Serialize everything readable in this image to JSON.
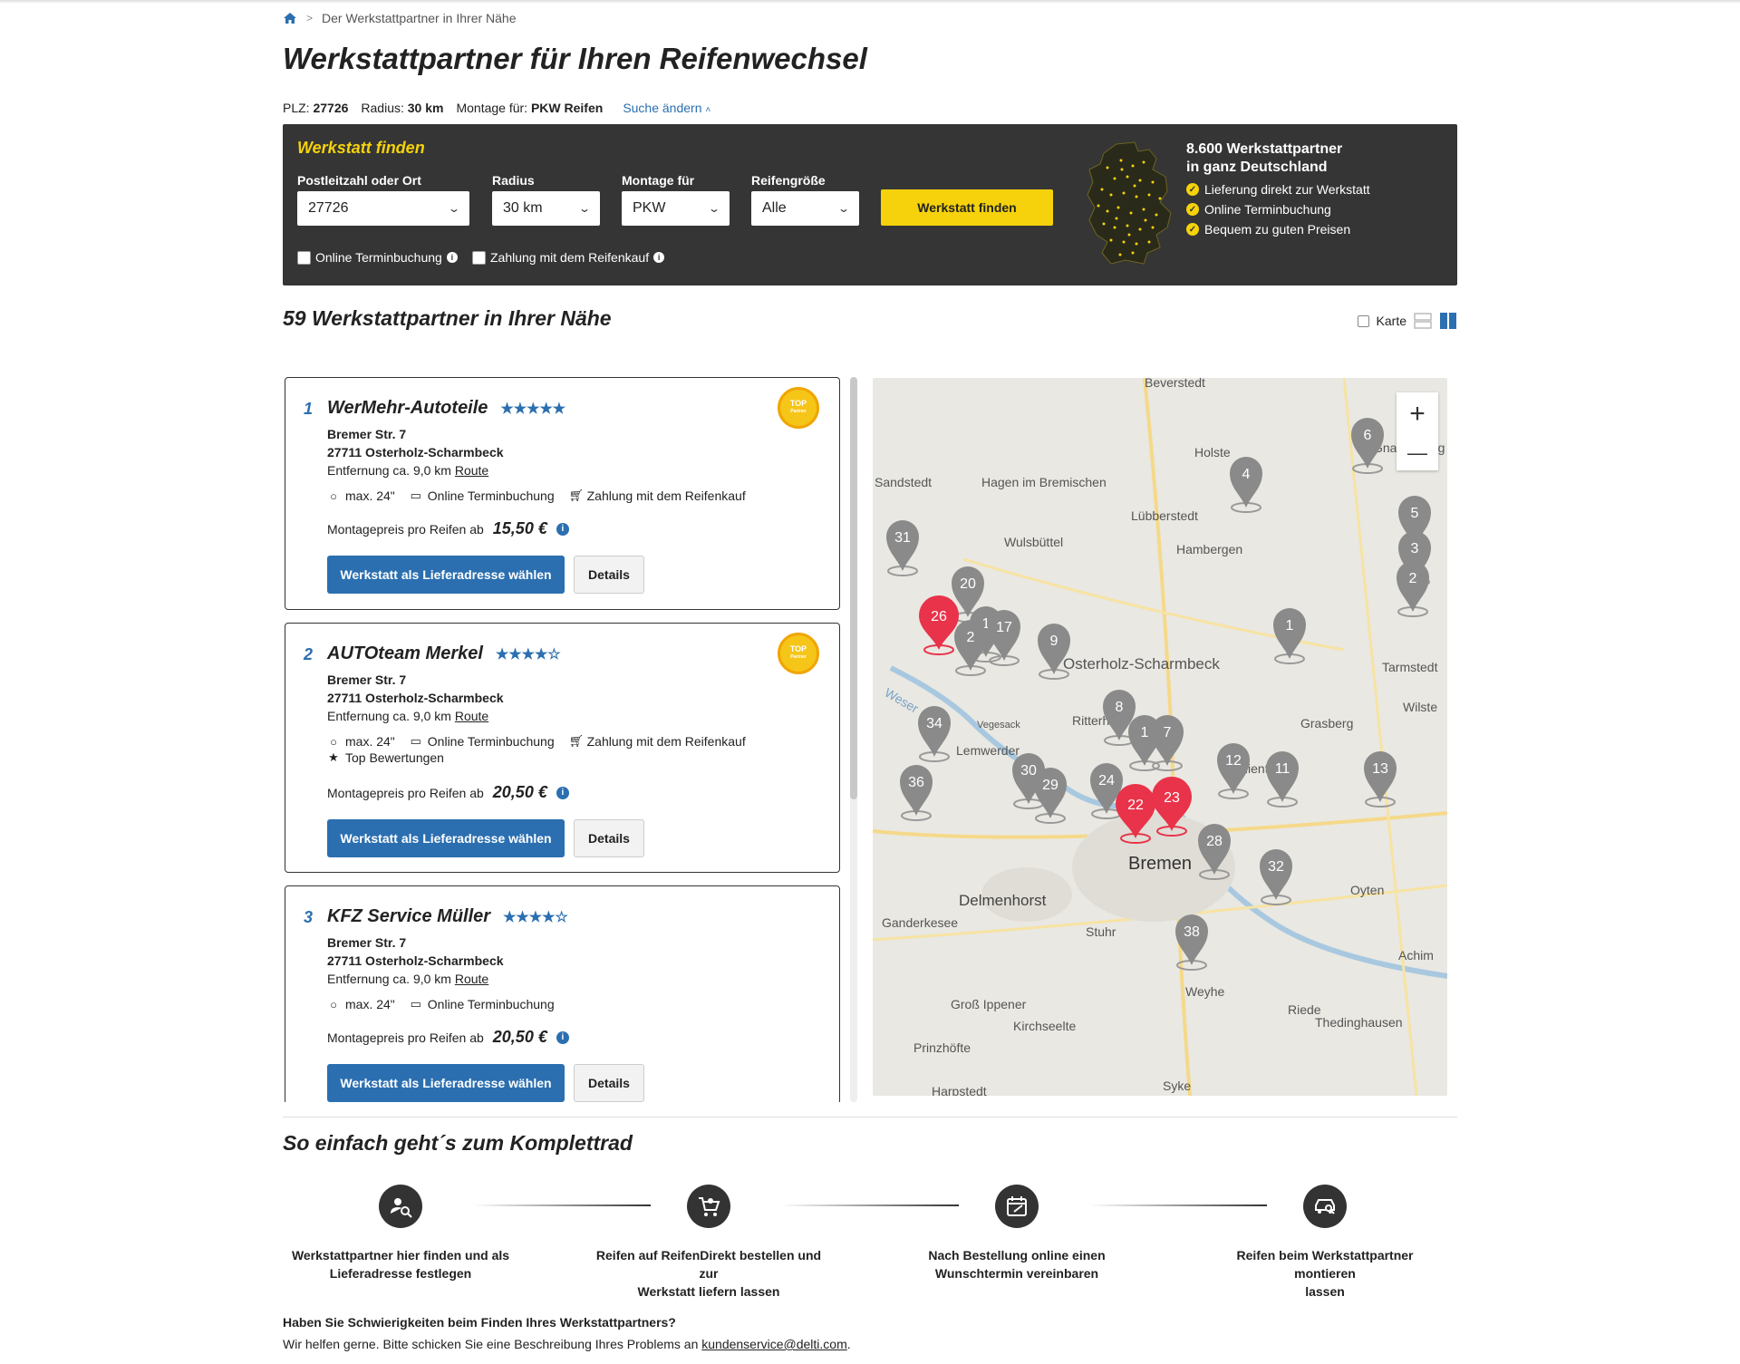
{
  "breadcrumb": {
    "home_icon": "home-icon",
    "current": "Der Werkstattpartner in Ihrer Nähe"
  },
  "page_title": "Werkstattpartner für Ihren Reifenwechsel",
  "summary": {
    "plz_label": "PLZ:",
    "plz_value": "27726",
    "radius_label": "Radius:",
    "radius_value": "30 km",
    "montage_label": "Montage für:",
    "montage_value": "PKW Reifen",
    "change_label": "Suche ändern"
  },
  "finder": {
    "title": "Werkstatt finden",
    "plz_label": "Postleitzahl oder Ort",
    "plz_value": "27726",
    "radius_label": "Radius",
    "radius_value": "30 km",
    "montage_label": "Montage für",
    "montage_value": "PKW",
    "size_label": "Reifengröße",
    "size_value": "Alle",
    "submit_label": "Werkstatt finden",
    "cb_online": "Online Terminbuchung",
    "cb_payment": "Zahlung mit dem Reifenkauf",
    "promo_title_1": "8.600 Werkstattpartner",
    "promo_title_2": "in ganz Deutschland",
    "promo_items": [
      "Lieferung direkt zur Werkstatt",
      "Online Terminbuchung",
      "Bequem zu guten Preisen"
    ]
  },
  "results": {
    "count_title": "59 Werkstattpartner in Ihrer Nähe",
    "map_toggle_label": "Karte"
  },
  "workshops": [
    {
      "num": "1",
      "name": "WerMehr-Autoteile",
      "rating": 5,
      "badge_top": "TOP",
      "badge_sub": "Partner",
      "street": "Bremer Str. 7",
      "city": "27711 Osterholz-Scharmbeck",
      "distance": "Entfernung ca. 9,0 km",
      "route": "Route",
      "f_max": "max. 24\"",
      "f_online": "Online Terminbuchung",
      "f_pay": "Zahlung mit dem Reifenkauf",
      "price_label": "Montagepreis pro Reifen ab",
      "price": "15,50 €",
      "btn_select": "Werkstatt als Lieferadresse wählen",
      "btn_details": "Details"
    },
    {
      "num": "2",
      "name": "AUTOteam Merkel",
      "rating": 4,
      "badge_top": "TOP",
      "badge_sub": "Partner",
      "street": "Bremer Str. 7",
      "city": "27711 Osterholz-Scharmbeck",
      "distance": "Entfernung ca. 9,0 km",
      "route": "Route",
      "f_max": "max. 24\"",
      "f_online": "Online Terminbuchung",
      "f_pay": "Zahlung mit dem Reifenkauf",
      "f_top": "Top Bewertungen",
      "price_label": "Montagepreis pro Reifen ab",
      "price": "20,50 €",
      "btn_select": "Werkstatt als Lieferadresse wählen",
      "btn_details": "Details"
    },
    {
      "num": "3",
      "name": "KFZ Service Müller",
      "rating": 4,
      "street": "Bremer Str. 7",
      "city": "27711 Osterholz-Scharmbeck",
      "distance": "Entfernung ca. 9,0 km",
      "route": "Route",
      "f_max": "max. 24\"",
      "f_online": "Online Terminbuchung",
      "price_label": "Montagepreis pro Reifen ab",
      "price": "20,50 €",
      "btn_select": "Werkstatt als Lieferadresse wählen",
      "btn_details": "Details"
    }
  ],
  "map": {
    "zoom_in": "+",
    "zoom_out": "—",
    "places": [
      "Beverstedt",
      "Holste",
      "Gnarrenburg",
      "Sandstedt",
      "Hagen im Bremischen",
      "Lübberstedt",
      "Wulsbüttel",
      "Hambergen",
      "Osterholz-Scharmbeck",
      "Tarmstedt",
      "Grasberg",
      "Wilste",
      "Vegesack",
      "Ritterhude",
      "Lemwerder",
      "Lilienthal",
      "Bremen",
      "Delmenhorst",
      "Oyten",
      "Ganderkesee",
      "Stuhr",
      "Achim",
      "Weyhe",
      "Groß Ippener",
      "Kirchseelte",
      "Riede",
      "Thedinghausen",
      "Prinzhöfte",
      "Syke",
      "Harpstedt",
      "Weser"
    ],
    "markers": [
      "6",
      "4",
      "5",
      "3",
      "2",
      "31",
      "20",
      "26",
      "1",
      "17",
      "2",
      "9",
      "1",
      "8",
      "1",
      "7",
      "34",
      "12",
      "11",
      "13",
      "36",
      "30",
      "29",
      "24",
      "22",
      "23",
      "28",
      "32",
      "38"
    ]
  },
  "howto": {
    "title": "So einfach geht´s zum Komplettrad",
    "steps": [
      {
        "icon": "search-user-icon",
        "line1": "Werkstattpartner hier finden und als",
        "line2": "Lieferadresse festlegen"
      },
      {
        "icon": "cart-icon",
        "line1": "Reifen auf ReifenDirekt bestellen und zur",
        "line2": "Werkstatt liefern lassen"
      },
      {
        "icon": "calendar-icon",
        "line1": "Nach Bestellung online einen",
        "line2": "Wunschtermin vereinbaren"
      },
      {
        "icon": "car-wrench-icon",
        "line1": "Reifen beim Werkstattpartner montieren",
        "line2": "lassen"
      }
    ]
  },
  "help": {
    "question": "Haben Sie Schwierigkeiten beim Finden Ihres Werkstattpartners?",
    "text": "Wir helfen gerne. Bitte schicken Sie eine Beschreibung Ihres Problems an",
    "email": "kundenservice@delti.com",
    "end": "."
  },
  "colors": {
    "accent_yellow": "#f5d20b",
    "link_blue": "#2b6fb0",
    "finder_bg": "#353535",
    "marker_red": "#e8334a",
    "marker_grey": "#8a8a8a"
  }
}
